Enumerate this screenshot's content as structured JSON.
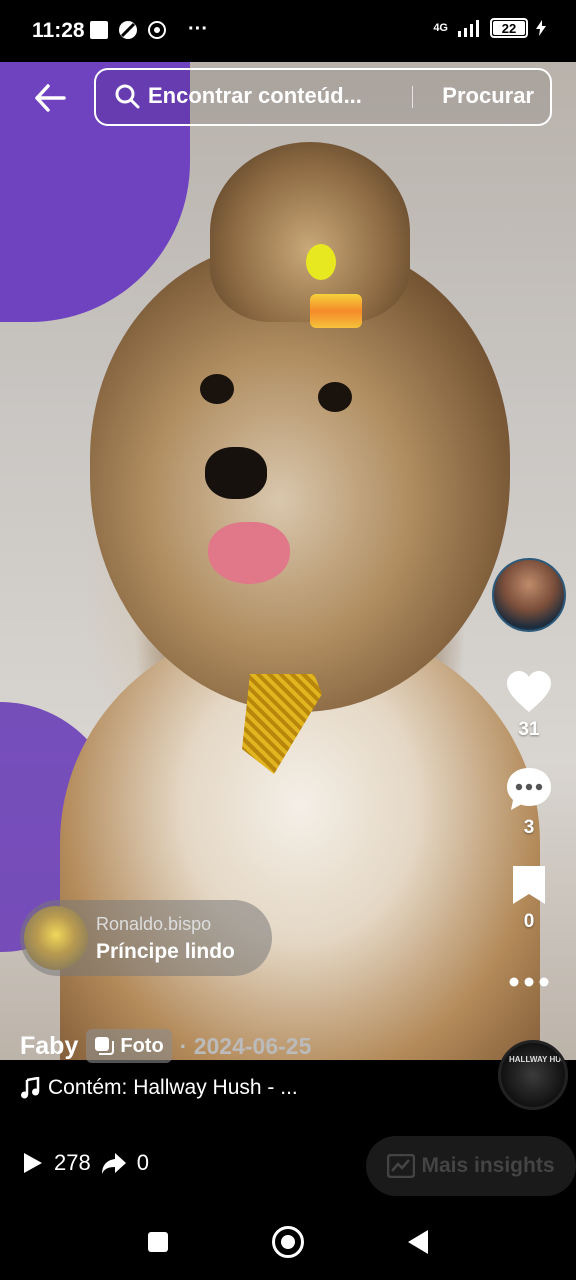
{
  "status": {
    "time": "11:28",
    "network": "4G",
    "battery": "22"
  },
  "search": {
    "placeholder": "Encontrar conteúd...",
    "button": "Procurar"
  },
  "rail": {
    "likes": "31",
    "comments": "3",
    "saves": "0"
  },
  "sticker": {
    "username": "Ronaldo.bispo",
    "title": "Príncipe lindo"
  },
  "meta": {
    "author": "Faby",
    "badge": "Foto",
    "date": "· 2024-06-25"
  },
  "music": {
    "text": "Contém: Hallway Hush - ...",
    "disc_label": "HALLWAY HUSH"
  },
  "stats": {
    "views": "278",
    "shares": "0"
  },
  "insights": {
    "label": "Mais insights"
  }
}
